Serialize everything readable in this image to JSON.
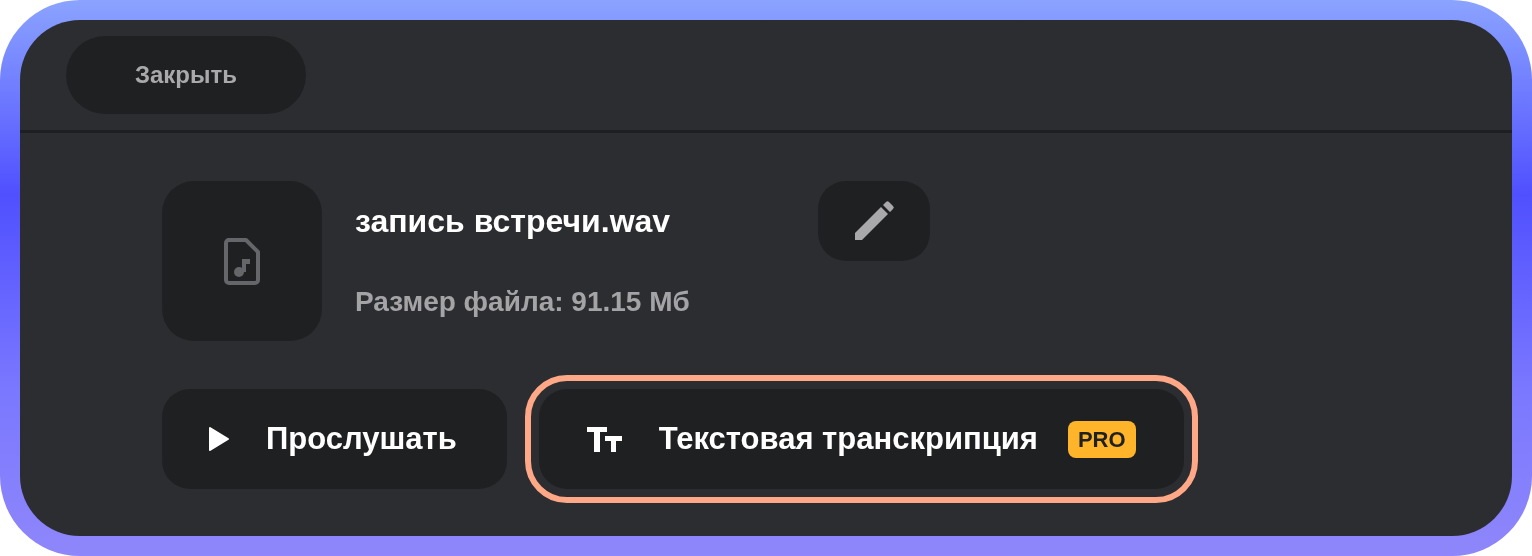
{
  "header": {
    "close_button": "Закрыть"
  },
  "file": {
    "name": "запись встречи.wav",
    "size": "Размер файла: 91.15 Мб"
  },
  "actions": [
    {
      "kind": "play",
      "label": "Прослушать",
      "highlighted": false
    },
    {
      "kind": "transcript",
      "label": "Текстовая транскрипция",
      "badge": "PRO",
      "highlighted": true
    }
  ]
}
